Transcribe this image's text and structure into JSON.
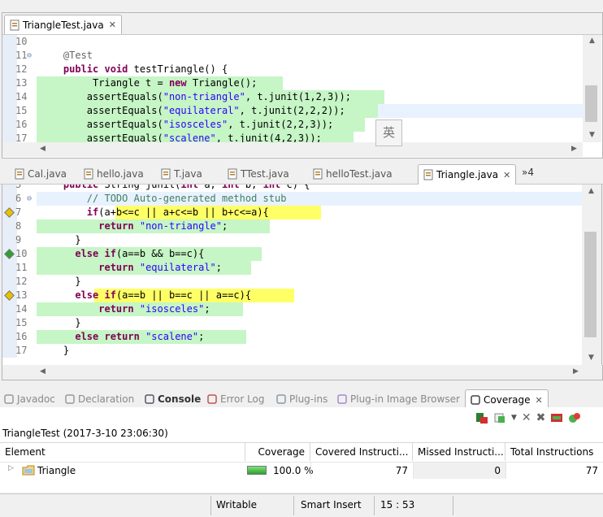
{
  "top_editor": {
    "tab_title": "TriangleTest.java",
    "lines": [
      {
        "n": "10",
        "parts": []
      },
      {
        "n": "11",
        "parts": [
          {
            "t": "    "
          },
          {
            "c": "an",
            "t": "@Test"
          }
        ]
      },
      {
        "n": "12",
        "parts": [
          {
            "t": "    "
          },
          {
            "c": "kw",
            "t": "public void"
          },
          {
            "t": " testTriangle() {"
          }
        ]
      },
      {
        "n": "13",
        "parts": [
          {
            "t": "         Triangle t = "
          },
          {
            "c": "kw",
            "t": "new"
          },
          {
            "t": " Triangle();"
          }
        ]
      },
      {
        "n": "14",
        "parts": [
          {
            "t": "        assertEquals("
          },
          {
            "c": "str",
            "t": "\"non-triangle\""
          },
          {
            "t": ", t.junit(1,2,3));"
          }
        ]
      },
      {
        "n": "15",
        "parts": [
          {
            "t": "        assertEquals("
          },
          {
            "c": "str",
            "t": "\"equilateral\""
          },
          {
            "t": ", t.junit(2,2,2));"
          }
        ]
      },
      {
        "n": "16",
        "parts": [
          {
            "t": "        assertEquals("
          },
          {
            "c": "str",
            "t": "\"isosceles\""
          },
          {
            "t": ", t.junit(2,2,3));"
          }
        ]
      },
      {
        "n": "17",
        "parts": [
          {
            "t": "        assertEquals("
          },
          {
            "c": "str",
            "t": "\"scalene\""
          },
          {
            "t": ", t.junit(4,2,3));"
          }
        ]
      }
    ],
    "ime_char": "英"
  },
  "mid_tabs": [
    {
      "label": "Cal.java",
      "icon": "java-file-icon"
    },
    {
      "label": "hello.java",
      "icon": "java-file-icon"
    },
    {
      "label": "T.java",
      "icon": "java-file-icon"
    },
    {
      "label": "TTest.java",
      "icon": "java-file-icon"
    },
    {
      "label": "helloTest.java",
      "icon": "java-file-icon"
    },
    {
      "label": "Triangle.java",
      "icon": "java-file-icon"
    }
  ],
  "mid_overflow": "»4",
  "main_editor": {
    "lines": [
      {
        "n": "5",
        "parts": [
          {
            "t": "    "
          },
          {
            "c": "kw",
            "t": "public"
          },
          {
            "t": " String junit("
          },
          {
            "c": "kw",
            "t": "int"
          },
          {
            "t": " a, "
          },
          {
            "c": "kw",
            "t": "int"
          },
          {
            "t": " b, "
          },
          {
            "c": "kw",
            "t": "int"
          },
          {
            "t": " c) {"
          }
        ]
      },
      {
        "n": "6",
        "parts": [
          {
            "t": "        "
          },
          {
            "c": "cm",
            "t": "// TODO Auto-generated method stub"
          }
        ]
      },
      {
        "n": "7",
        "parts": [
          {
            "t": "        "
          },
          {
            "c": "kw",
            "t": "if"
          },
          {
            "t": "(a+b<=c || a+c<=b || b+c<=a){"
          }
        ]
      },
      {
        "n": "8",
        "parts": [
          {
            "t": "          "
          },
          {
            "c": "kw",
            "t": "return"
          },
          {
            "t": " "
          },
          {
            "c": "str",
            "t": "\"non-triangle\""
          },
          {
            "t": ";"
          }
        ]
      },
      {
        "n": "9",
        "parts": [
          {
            "t": "      }"
          }
        ]
      },
      {
        "n": "10",
        "parts": [
          {
            "t": "      "
          },
          {
            "c": "kw",
            "t": "else if"
          },
          {
            "t": "(a==b && b==c){"
          }
        ]
      },
      {
        "n": "11",
        "parts": [
          {
            "t": "          "
          },
          {
            "c": "kw",
            "t": "return"
          },
          {
            "t": " "
          },
          {
            "c": "str",
            "t": "\"equilateral\""
          },
          {
            "t": ";"
          }
        ]
      },
      {
        "n": "12",
        "parts": [
          {
            "t": "      }"
          }
        ]
      },
      {
        "n": "13",
        "parts": [
          {
            "t": "      "
          },
          {
            "c": "kw",
            "t": "else if"
          },
          {
            "t": "(a==b || b==c || a==c){"
          }
        ]
      },
      {
        "n": "14",
        "parts": [
          {
            "t": "          "
          },
          {
            "c": "kw",
            "t": "return"
          },
          {
            "t": " "
          },
          {
            "c": "str",
            "t": "\"isosceles\""
          },
          {
            "t": ";"
          }
        ]
      },
      {
        "n": "15",
        "parts": [
          {
            "t": "      }"
          }
        ]
      },
      {
        "n": "16",
        "parts": [
          {
            "t": "      "
          },
          {
            "c": "kw",
            "t": "else return"
          },
          {
            "t": " "
          },
          {
            "c": "str",
            "t": "\"scalene\""
          },
          {
            "t": ";"
          }
        ]
      },
      {
        "n": "17",
        "parts": [
          {
            "t": "    }"
          }
        ]
      }
    ]
  },
  "views": [
    {
      "label": "Javadoc",
      "icon": "javadoc-icon"
    },
    {
      "label": "Declaration",
      "icon": "declaration-icon"
    },
    {
      "label": "Console",
      "icon": "console-icon"
    },
    {
      "label": "Error Log",
      "icon": "error-log-icon"
    },
    {
      "label": "Plug-ins",
      "icon": "plugins-icon"
    },
    {
      "label": "Plug-in Image Browser",
      "icon": "image-browser-icon"
    },
    {
      "label": "Coverage",
      "icon": "coverage-icon"
    }
  ],
  "coverage": {
    "session": "TriangleTest (2017-3-10 23:06:30)",
    "columns": [
      "Element",
      "Coverage",
      "Covered Instructi...",
      "Missed Instructi...",
      "Total Instructions"
    ],
    "row": {
      "element": "Triangle",
      "coverage": "100.0 %",
      "covered": "77",
      "missed": "0",
      "total": "77",
      "coverage_fraction": 1.0
    }
  },
  "status": {
    "mode": "Writable",
    "insert": "Smart Insert",
    "position": "15 : 53"
  },
  "colors": {
    "covered": "#c6f5c6",
    "partial": "#ffff66",
    "keyword": "#7f0055",
    "string": "#2a00ff",
    "comment": "#3f7f5f"
  }
}
